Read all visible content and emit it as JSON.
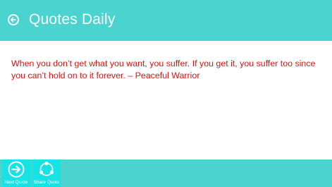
{
  "header": {
    "title": "Quotes Daily",
    "back_icon": "back-arrow-circle-icon"
  },
  "quote": {
    "text": "When you don’t get what you want, you suffer. If you get it, you suffer too since you can’t hold on to it forever. – Peaceful Warrior"
  },
  "appbar": {
    "next": {
      "label": "Next Quote",
      "icon": "arrow-right-circle-icon"
    },
    "share": {
      "label": "Share Quote",
      "icon": "share-circle-icon"
    }
  },
  "colors": {
    "accent": "#4ad3cf",
    "button_bg": "#15e3e6",
    "quote_text": "#e01010",
    "header_text": "#ffffff"
  }
}
